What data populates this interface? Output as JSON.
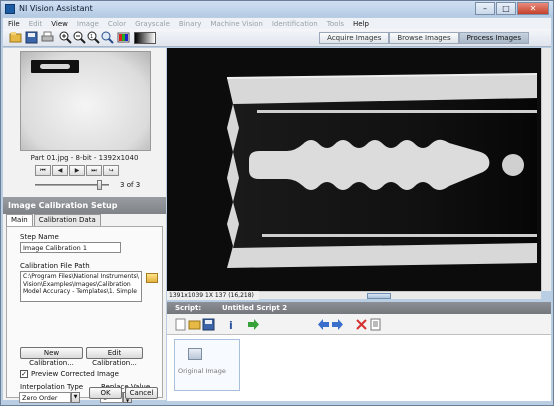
{
  "window": {
    "title": "NI Vision Assistant",
    "minimize": "–",
    "maximize": "□",
    "close": "✕"
  },
  "menu": [
    "File",
    "Edit",
    "View",
    "Image",
    "Color",
    "Grayscale",
    "Binary",
    "Machine Vision",
    "Identification",
    "Tools",
    "Help"
  ],
  "menu_enabled": [
    true,
    false,
    true,
    false,
    false,
    false,
    false,
    false,
    false,
    false,
    true
  ],
  "toolbar": {
    "acquire": "Acquire Images",
    "browse": "Browse Images",
    "process": "Process Images"
  },
  "thumbnail": {
    "caption": "Part 01.jpg - 8-bit - 1392x1040",
    "current": "3",
    "of": "of",
    "total": "3"
  },
  "nav_buttons": [
    "⏮",
    "◀",
    "▶",
    "⏭",
    "↪"
  ],
  "panel": {
    "title": "Image Calibration Setup",
    "tabs": [
      "Main",
      "Calibration Data"
    ],
    "step_name_label": "Step Name",
    "step_name_value": "Image Calibration 1",
    "file_path_label": "Calibration File Path",
    "file_path_value": "C:\\Program Files\\National Instruments\\ Vision\\Examples\\Images\\Calibration Model Accuracy - Templates\\1. Simple",
    "new_calibration": "New Calibration...",
    "edit_calibration": "Edit Calibration...",
    "preview_label": "Preview Corrected Image",
    "preview_checked": "✓",
    "interp_label": "Interpolation Type",
    "interp_value": "Zero Order",
    "replace_label": "Replace Value",
    "replace_value": "0",
    "ok": "OK",
    "cancel": "Cancel"
  },
  "status": {
    "info": "1391x1039 1X 137   (16,218)"
  },
  "script": {
    "label": "Script:",
    "name": "Untitled Script 2",
    "step_label": "Original Image"
  },
  "colors": {
    "title_bar": "#c2d6ec",
    "panel_header": "#8a8e93",
    "image_bg": "#0c0c0c",
    "blade_slot": "#d9d9d9"
  }
}
